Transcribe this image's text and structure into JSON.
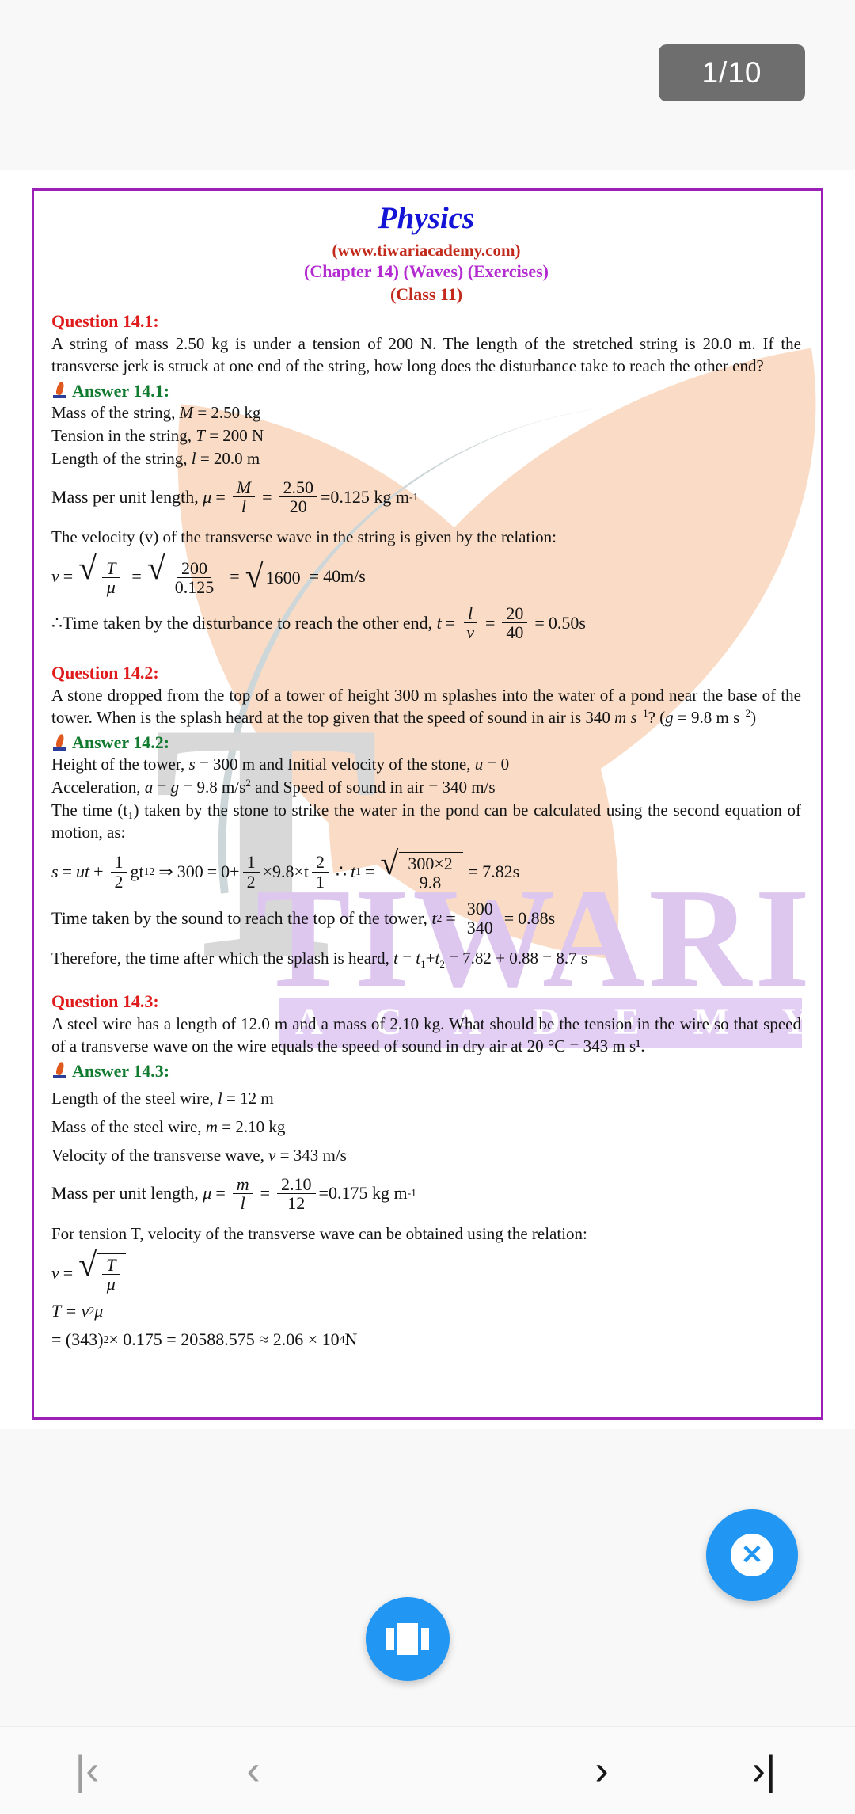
{
  "viewer": {
    "page_indicator": "1/10",
    "close_button_label": "✕",
    "carousel_icon_name": "view-carousel-icon",
    "nav": {
      "first_label": "|‹",
      "prev_label": "‹",
      "next_label": "›",
      "last_label": "›|"
    }
  },
  "document": {
    "title": "Physics",
    "website": "(www.tiwariacademy.com)",
    "chapter": "(Chapter 14) (Waves) (Exercises)",
    "class": "(Class 11)",
    "border_color": "#9a20b8",
    "title_color": "#1414d6",
    "website_color": "#c22a1c",
    "chapter_color": "#b22ad0",
    "question_color": "#e01b1b",
    "answer_color": "#107a2e",
    "watermark": {
      "letter": "T",
      "brand": "TIWARI",
      "sub_brand": "A C A D E M Y"
    },
    "q1": {
      "heading": "Question 14.1:",
      "text": "A string of mass 2.50 kg is under a tension of 200 N. The length of the stretched string is 20.0 m. If the transverse jerk is struck at one end of the string, how long does the disturbance take to reach the other end?",
      "answer_heading": "Answer 14.1:",
      "given": [
        {
          "label": "Mass of the string,",
          "sym": "M",
          "eq": "=",
          "val": "2.50 kg"
        },
        {
          "label": "Tension in the string,",
          "sym": "T",
          "eq": "=",
          "val": "200 N"
        },
        {
          "label": "Length of the string,",
          "sym": "l",
          "eq": "=",
          "val": "20.0 m"
        }
      ],
      "mu_label": "Mass per unit length,",
      "mu_sym": "μ",
      "mu_n1": "M",
      "mu_d1": "l",
      "mu_n2": "2.50",
      "mu_d2": "20",
      "mu_result": "=0.125 kg m",
      "mu_result_exp": "-1",
      "velocity_intro": "The velocity (v) of the transverse wave in the string is given by the relation:",
      "v_sym": "v",
      "v_n1": "T",
      "v_d1": "μ",
      "v_n2": "200",
      "v_d2": "0.125",
      "v_root": "1600",
      "v_result": "40m/s",
      "time_intro": "∴Time taken by the disturbance to reach the other end,",
      "t_sym": "t",
      "t_n1": "l",
      "t_d1": "v",
      "t_n2": "20",
      "t_d2": "40",
      "t_result": "0.50s"
    },
    "q2": {
      "heading": "Question 14.2:",
      "text_a": "A stone dropped from the top of a tower of height 300 m splashes into the water of a pond near the base of the tower. When is the splash heard at the top given that the speed of sound in air is",
      "text_b_pre": "340 ",
      "text_b_mi": "m s",
      "text_b_exp": "−1",
      "text_b_mid": "? (",
      "text_b_g": "g",
      "text_b_post": " = 9.8 m s",
      "text_b_exp2": "−2",
      "text_b_end": ")",
      "answer_heading": "Answer 14.2:",
      "line1_a": "Height of the tower,",
      "line1_s": "s",
      "line1_b": " = 300 m and Initial velocity of the stone,",
      "line1_u": "u",
      "line1_c": " = 0",
      "line2_a": "Acceleration,",
      "line2_sym1": "a",
      "line2_b": " = ",
      "line2_sym2": "g",
      "line2_c": " = 9.8 m/s",
      "line2_exp": "2",
      "line2_d": " and Speed of sound in air = 340 m/s",
      "line3": "The time (t₁) taken by the stone to strike the water in the pond can be calculated using the second equation of motion, as:",
      "eq_s": "s",
      "eq_ut": "ut",
      "eq_half_n": "1",
      "eq_half_d": "2",
      "eq_g": "gt",
      "eq_g_sub": "1",
      "eq_g_sup": "2",
      "eq_arrow": "⇒",
      "eq_300": "300",
      "eq_0plus": "0+",
      "eq_half2_n": "1",
      "eq_half2_d": "2",
      "eq_98": "×9.8×t",
      "eq_21_n": "2",
      "eq_21_d": "1",
      "eq_therefore": "∴",
      "eq_t1": "t",
      "eq_t1_sub": "1",
      "eq_root_n": "300×2",
      "eq_root_d": "9.8",
      "eq_res": "7.82s",
      "t2_intro": "Time taken by the sound to reach the top of the tower,",
      "t2_sym": "t",
      "t2_sub": "2",
      "t2_n": "300",
      "t2_d": "340",
      "t2_res": "0.88s",
      "final_a": "Therefore, the time after which the splash is heard,",
      "final_t": "t",
      "final_b": " = ",
      "final_t1": "t",
      "final_t1_sub": "1",
      "final_plus": "+",
      "final_t2": "t",
      "final_t2_sub": "2",
      "final_c": " = 7.82 + 0.88 = 8.7 s"
    },
    "q3": {
      "heading": "Question 14.3:",
      "text": "A steel wire has a length of 12.0 m and a mass of 2.10 kg. What should be the tension in the wire so that speed of a transverse wave on the wire equals the speed of sound in dry air at 20 °C = 343 m s¹.",
      "answer_heading": "Answer 14.3:",
      "given": [
        {
          "label": "Length of the steel wire,",
          "sym": "l",
          "eq": "=",
          "val": "12 m"
        },
        {
          "label": "Mass of the steel wire,",
          "sym": "m",
          "eq": "=",
          "val": "2.10 kg"
        },
        {
          "label": "Velocity of the transverse wave,",
          "sym": "v",
          "eq": "=",
          "val": "343 m/s"
        }
      ],
      "mu_label": "Mass per unit length,",
      "mu_sym": "μ",
      "mu_n1": "m",
      "mu_d1": "l",
      "mu_n2": "2.10",
      "mu_d2": "12",
      "mu_result": "=0.175 kg m",
      "mu_result_exp": "-1",
      "tension_intro": "For tension T, velocity of the transverse wave can be obtained using the relation:",
      "v_sym": "v",
      "v_n1": "T",
      "v_d1": "μ",
      "t_line": "T  =  v",
      "t_line_exp": "2",
      "t_line_mu": " μ",
      "final_line": "=  (343)",
      "final_exp": "2",
      "final_rest": " × 0.175 = 20588.575  ≈  2.06  ×  10",
      "final_exp2": "4",
      "final_unit": " N"
    }
  }
}
